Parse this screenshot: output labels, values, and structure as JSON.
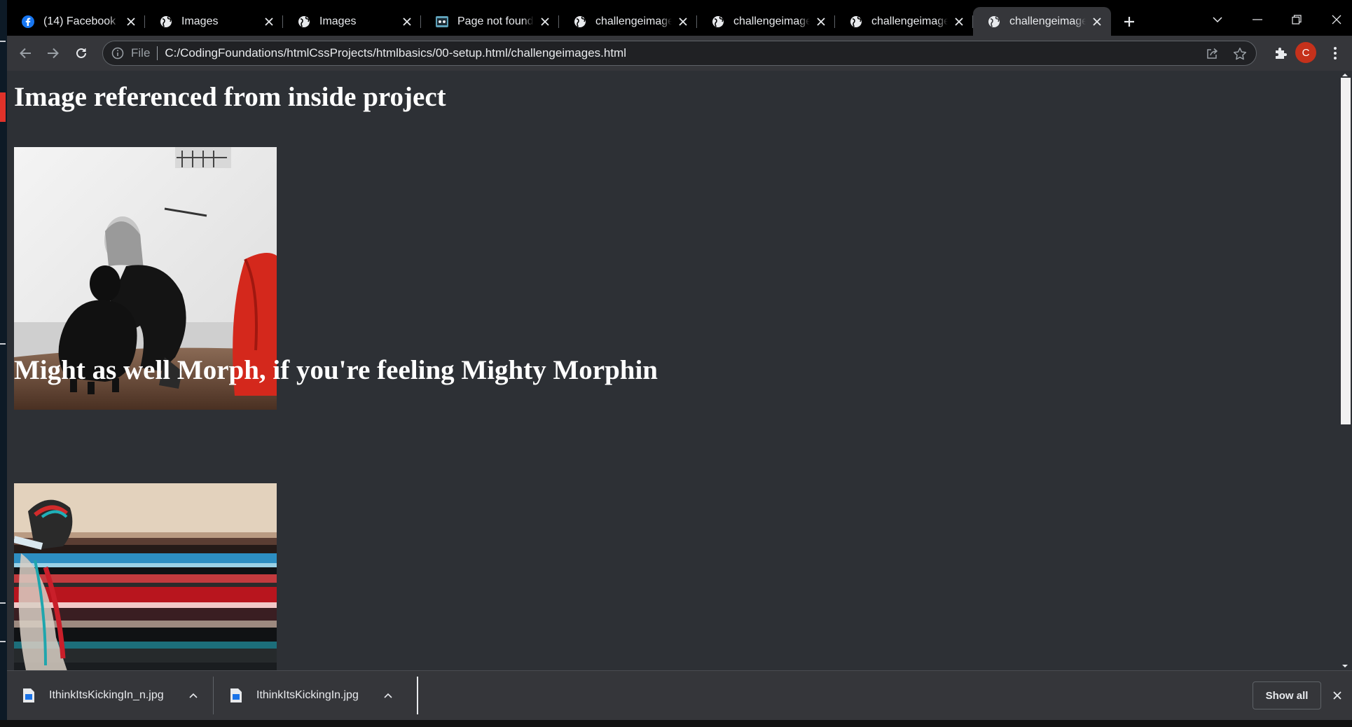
{
  "browser": {
    "tabs": [
      {
        "title": "(14) Facebook",
        "favicon": "facebook-icon",
        "active": false
      },
      {
        "title": "Images",
        "favicon": "globe-icon",
        "active": false
      },
      {
        "title": "Images",
        "favicon": "globe-icon",
        "active": false
      },
      {
        "title": "Page not found -",
        "favicon": "page-not-found-icon",
        "active": false
      },
      {
        "title": "challengeimages.h",
        "favicon": "globe-icon",
        "active": false
      },
      {
        "title": "challengeimages.h",
        "favicon": "globe-icon",
        "active": false
      },
      {
        "title": "challengeimages.h",
        "favicon": "globe-icon",
        "active": false
      },
      {
        "title": "challengeimages.h",
        "favicon": "globe-icon",
        "active": true
      }
    ],
    "address": {
      "scheme_label": "File",
      "url": "C:/CodingFoundations/htmlCssProjects/htmlbasics/00-setup.html/challengeimages.html"
    },
    "profile_initial": "C",
    "colors": {
      "accent_avatar": "#c5311b",
      "page_background": "#2d3035",
      "frame": "#35363a"
    }
  },
  "page": {
    "heading_1": "Image referenced from inside project",
    "image_1_desc": "person-crouching-with-dog-photo",
    "heading_2": "Might as well Morph, if you're feeling Mighty Morphin",
    "image_2_desc": "glitch-distorted-person-photo"
  },
  "downloads": {
    "items": [
      {
        "filename": "IthinkItsKickingIn_n.jpg"
      },
      {
        "filename": "IthinkItsKickingIn.jpg"
      }
    ],
    "show_all_label": "Show all"
  }
}
